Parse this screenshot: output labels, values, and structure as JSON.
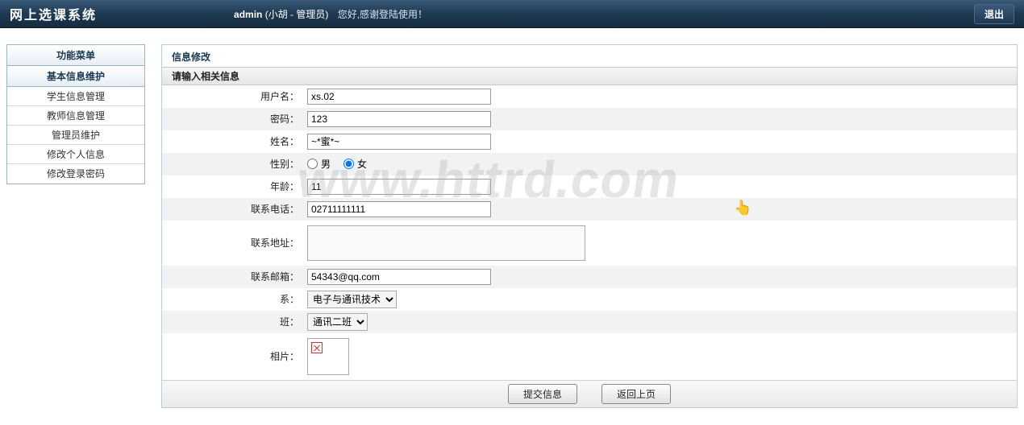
{
  "header": {
    "title": "网上选课系统",
    "login_label": "admin",
    "user_display": "(小胡 - 管理员)",
    "greeting": "您好,感谢登陆使用！",
    "logout_label": "退出"
  },
  "sidebar": {
    "section1_title": "功能菜单",
    "section2_title": "基本信息维护",
    "items": [
      "学生信息管理",
      "教师信息管理",
      "管理员维护",
      "修改个人信息",
      "修改登录密码"
    ]
  },
  "panel": {
    "title": "信息修改",
    "subtitle": "请输入相关信息"
  },
  "form": {
    "labels": {
      "username": "用户名：",
      "password": "密码：",
      "realname": "姓名：",
      "gender": "性别：",
      "age": "年龄：",
      "phone": "联系电话：",
      "address": "联系地址：",
      "email": "联系邮箱：",
      "dept": "系：",
      "clazz": "班：",
      "photo": "相片："
    },
    "values": {
      "username": "xs.02",
      "password": "123",
      "realname": "~*蜜*~",
      "age": "11",
      "phone": "02711111111",
      "address": "",
      "email": "54343@qq.com",
      "dept": "电子与通讯技术",
      "clazz": "通讯二班"
    },
    "gender": {
      "male_label": "男",
      "female_label": "女",
      "selected": "female"
    }
  },
  "actions": {
    "submit": "提交信息",
    "back": "返回上页"
  },
  "watermark": "www.httrd.com"
}
